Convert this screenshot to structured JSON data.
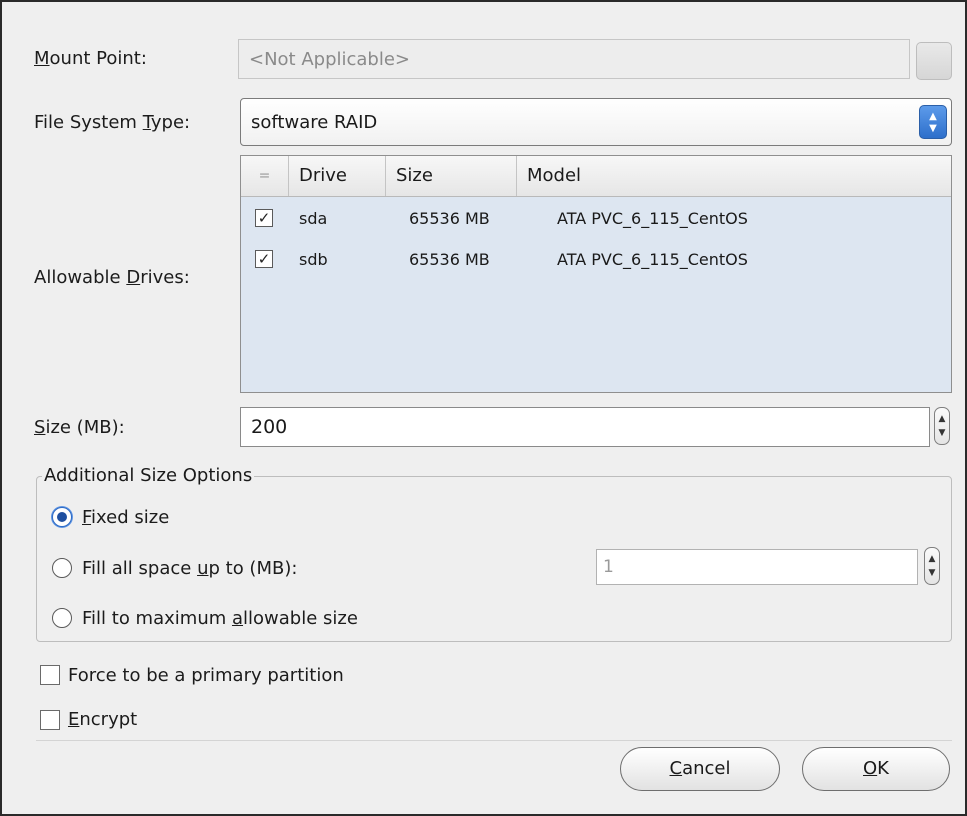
{
  "mount_point": {
    "label_prefix": "",
    "label_mnemonic": "M",
    "label_rest": "ount Point:",
    "placeholder": "<Not Applicable>"
  },
  "filesystem": {
    "label_prefix": "File System ",
    "label_mnemonic": "T",
    "label_rest": "ype:",
    "value": "software RAID"
  },
  "drives": {
    "label_prefix": "Allowable ",
    "label_mnemonic": "D",
    "label_rest": "rives:",
    "headers": {
      "check": "=",
      "drive": "Drive",
      "size": "Size",
      "model": "Model"
    },
    "rows": [
      {
        "checked": true,
        "drive": "sda",
        "size": "65536 MB",
        "model": "ATA PVC_6_115_CentOS"
      },
      {
        "checked": true,
        "drive": "sdb",
        "size": "65536 MB",
        "model": "ATA PVC_6_115_CentOS"
      }
    ]
  },
  "size": {
    "label_mnemonic": "S",
    "label_rest": "ize (MB):",
    "value": "200"
  },
  "options": {
    "title": "Additional Size Options",
    "fixed": {
      "mnemonic": "F",
      "rest": "ixed size",
      "selected": true
    },
    "fill_upto": {
      "prefix": "Fill all space ",
      "mnemonic": "u",
      "rest": "p to (MB):",
      "value": "1"
    },
    "fill_max": {
      "prefix": "Fill to maximum ",
      "mnemonic": "a",
      "rest": "llowable size"
    }
  },
  "primary": {
    "label": "Force to be a primary partition"
  },
  "encrypt": {
    "mnemonic": "E",
    "rest": "ncrypt"
  },
  "buttons": {
    "cancel": {
      "mnemonic": "C",
      "rest": "ancel"
    },
    "ok": {
      "mnemonic": "O",
      "rest": "K"
    }
  }
}
